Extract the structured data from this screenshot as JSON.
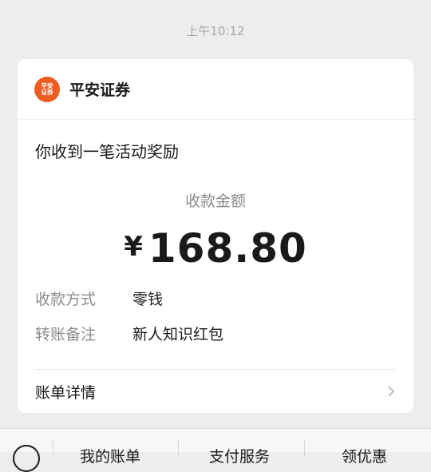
{
  "timestamp": "上午10:12",
  "card": {
    "logo_text": "平安证券",
    "brand": "平安证券",
    "notice": "你收到一笔活动奖励",
    "amount_label": "收款金额",
    "currency_symbol": "¥",
    "amount": "168.80",
    "rows": [
      {
        "key": "收款方式",
        "value": "零钱"
      },
      {
        "key": "转账备注",
        "value": "新人知识红包"
      }
    ],
    "detail_link": "账单详情",
    "detail_icon": "chevron-right-icon"
  },
  "bottom_menu": {
    "items": [
      "我的账单",
      "支付服务",
      "领优惠"
    ]
  },
  "colors": {
    "background": "#ededed",
    "card": "#ffffff",
    "logo": "#ee5d22",
    "muted_text": "#8c8c8c"
  }
}
